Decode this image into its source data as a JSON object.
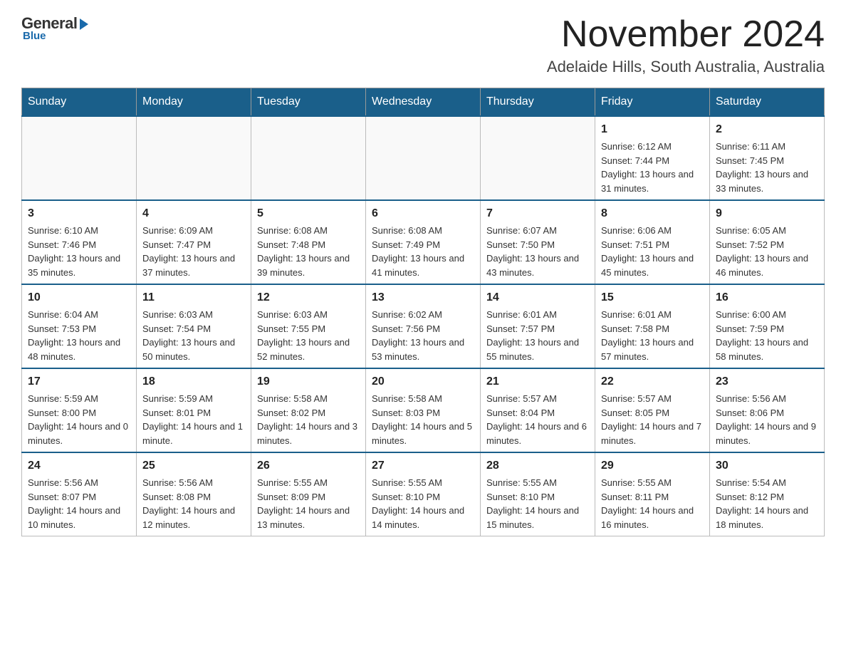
{
  "header": {
    "logo": {
      "general": "General",
      "blue": "Blue"
    },
    "month_title": "November 2024",
    "location": "Adelaide Hills, South Australia, Australia"
  },
  "days_of_week": [
    "Sunday",
    "Monday",
    "Tuesday",
    "Wednesday",
    "Thursday",
    "Friday",
    "Saturday"
  ],
  "weeks": [
    [
      {
        "day": "",
        "info": ""
      },
      {
        "day": "",
        "info": ""
      },
      {
        "day": "",
        "info": ""
      },
      {
        "day": "",
        "info": ""
      },
      {
        "day": "",
        "info": ""
      },
      {
        "day": "1",
        "info": "Sunrise: 6:12 AM\nSunset: 7:44 PM\nDaylight: 13 hours and 31 minutes."
      },
      {
        "day": "2",
        "info": "Sunrise: 6:11 AM\nSunset: 7:45 PM\nDaylight: 13 hours and 33 minutes."
      }
    ],
    [
      {
        "day": "3",
        "info": "Sunrise: 6:10 AM\nSunset: 7:46 PM\nDaylight: 13 hours and 35 minutes."
      },
      {
        "day": "4",
        "info": "Sunrise: 6:09 AM\nSunset: 7:47 PM\nDaylight: 13 hours and 37 minutes."
      },
      {
        "day": "5",
        "info": "Sunrise: 6:08 AM\nSunset: 7:48 PM\nDaylight: 13 hours and 39 minutes."
      },
      {
        "day": "6",
        "info": "Sunrise: 6:08 AM\nSunset: 7:49 PM\nDaylight: 13 hours and 41 minutes."
      },
      {
        "day": "7",
        "info": "Sunrise: 6:07 AM\nSunset: 7:50 PM\nDaylight: 13 hours and 43 minutes."
      },
      {
        "day": "8",
        "info": "Sunrise: 6:06 AM\nSunset: 7:51 PM\nDaylight: 13 hours and 45 minutes."
      },
      {
        "day": "9",
        "info": "Sunrise: 6:05 AM\nSunset: 7:52 PM\nDaylight: 13 hours and 46 minutes."
      }
    ],
    [
      {
        "day": "10",
        "info": "Sunrise: 6:04 AM\nSunset: 7:53 PM\nDaylight: 13 hours and 48 minutes."
      },
      {
        "day": "11",
        "info": "Sunrise: 6:03 AM\nSunset: 7:54 PM\nDaylight: 13 hours and 50 minutes."
      },
      {
        "day": "12",
        "info": "Sunrise: 6:03 AM\nSunset: 7:55 PM\nDaylight: 13 hours and 52 minutes."
      },
      {
        "day": "13",
        "info": "Sunrise: 6:02 AM\nSunset: 7:56 PM\nDaylight: 13 hours and 53 minutes."
      },
      {
        "day": "14",
        "info": "Sunrise: 6:01 AM\nSunset: 7:57 PM\nDaylight: 13 hours and 55 minutes."
      },
      {
        "day": "15",
        "info": "Sunrise: 6:01 AM\nSunset: 7:58 PM\nDaylight: 13 hours and 57 minutes."
      },
      {
        "day": "16",
        "info": "Sunrise: 6:00 AM\nSunset: 7:59 PM\nDaylight: 13 hours and 58 minutes."
      }
    ],
    [
      {
        "day": "17",
        "info": "Sunrise: 5:59 AM\nSunset: 8:00 PM\nDaylight: 14 hours and 0 minutes."
      },
      {
        "day": "18",
        "info": "Sunrise: 5:59 AM\nSunset: 8:01 PM\nDaylight: 14 hours and 1 minute."
      },
      {
        "day": "19",
        "info": "Sunrise: 5:58 AM\nSunset: 8:02 PM\nDaylight: 14 hours and 3 minutes."
      },
      {
        "day": "20",
        "info": "Sunrise: 5:58 AM\nSunset: 8:03 PM\nDaylight: 14 hours and 5 minutes."
      },
      {
        "day": "21",
        "info": "Sunrise: 5:57 AM\nSunset: 8:04 PM\nDaylight: 14 hours and 6 minutes."
      },
      {
        "day": "22",
        "info": "Sunrise: 5:57 AM\nSunset: 8:05 PM\nDaylight: 14 hours and 7 minutes."
      },
      {
        "day": "23",
        "info": "Sunrise: 5:56 AM\nSunset: 8:06 PM\nDaylight: 14 hours and 9 minutes."
      }
    ],
    [
      {
        "day": "24",
        "info": "Sunrise: 5:56 AM\nSunset: 8:07 PM\nDaylight: 14 hours and 10 minutes."
      },
      {
        "day": "25",
        "info": "Sunrise: 5:56 AM\nSunset: 8:08 PM\nDaylight: 14 hours and 12 minutes."
      },
      {
        "day": "26",
        "info": "Sunrise: 5:55 AM\nSunset: 8:09 PM\nDaylight: 14 hours and 13 minutes."
      },
      {
        "day": "27",
        "info": "Sunrise: 5:55 AM\nSunset: 8:10 PM\nDaylight: 14 hours and 14 minutes."
      },
      {
        "day": "28",
        "info": "Sunrise: 5:55 AM\nSunset: 8:10 PM\nDaylight: 14 hours and 15 minutes."
      },
      {
        "day": "29",
        "info": "Sunrise: 5:55 AM\nSunset: 8:11 PM\nDaylight: 14 hours and 16 minutes."
      },
      {
        "day": "30",
        "info": "Sunrise: 5:54 AM\nSunset: 8:12 PM\nDaylight: 14 hours and 18 minutes."
      }
    ]
  ]
}
